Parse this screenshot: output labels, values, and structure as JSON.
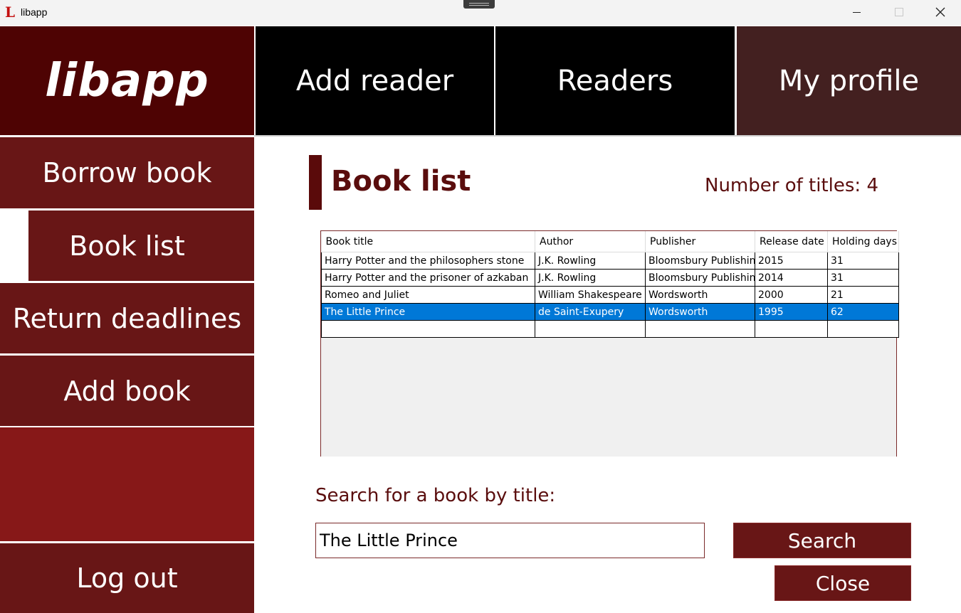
{
  "window": {
    "title": "libapp",
    "icon_letter": "L",
    "accent": "#c41010"
  },
  "logo": {
    "text": "libapp"
  },
  "topnav": {
    "add_reader": "Add reader",
    "readers": "Readers",
    "my_profile": "My profile"
  },
  "sidebar": {
    "items": [
      {
        "label": "Borrow book"
      },
      {
        "label": "Book list",
        "active": true
      },
      {
        "label": "Return deadlines"
      },
      {
        "label": "Add book"
      }
    ],
    "logout": "Log out"
  },
  "main": {
    "title": "Book list",
    "count_label": "Number of titles:",
    "count_value": "4",
    "table": {
      "headers": [
        "Book title",
        "Author",
        "Publisher",
        "Release date",
        "Holding days"
      ],
      "rows": [
        [
          "Harry Potter and the philosophers stone",
          "J.K. Rowling",
          "Bloomsbury Publishin",
          "2015",
          "31"
        ],
        [
          "Harry Potter and the prisoner of azkaban",
          "J.K. Rowling",
          "Bloomsbury Publishin",
          "2014",
          "31"
        ],
        [
          "Romeo and Juliet",
          "William Shakespeare",
          "Wordsworth",
          "2000",
          "21"
        ],
        [
          "The Little Prince",
          "de Saint-Exupery",
          "Wordsworth",
          "1995",
          "62"
        ]
      ],
      "selected_row": 3
    },
    "search_label": "Search for a book by title:",
    "search_value": "The Little Prince",
    "search_button": "Search",
    "close_button": "Close"
  },
  "colors": {
    "logo_bg": "#4e0303",
    "sidebar_bg": "#681616",
    "sidebar_filler": "#871818",
    "profile_bg": "#432020",
    "heading_text": "#5a0d0d",
    "selection": "#0078d7"
  }
}
